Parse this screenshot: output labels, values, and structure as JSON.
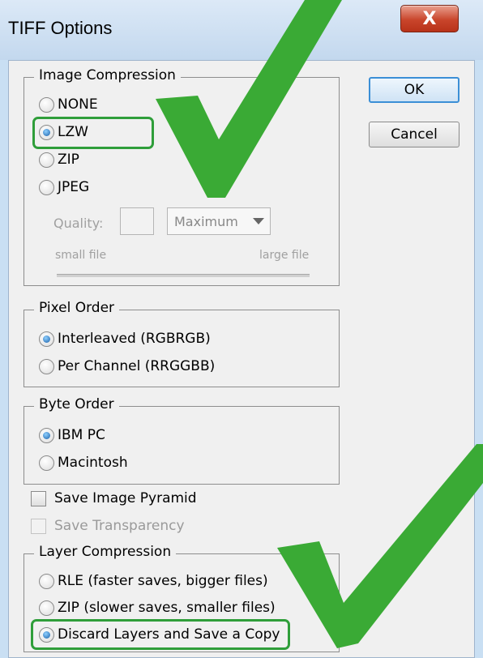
{
  "window": {
    "title": "TIFF Options",
    "close_label": "X"
  },
  "buttons": {
    "ok_label": "OK",
    "cancel_label": "Cancel"
  },
  "image_compression": {
    "legend": "Image Compression",
    "options": [
      "NONE",
      "LZW",
      "ZIP",
      "JPEG"
    ],
    "selected": "LZW",
    "quality_label": "Quality:",
    "quality_value": "",
    "quality_select": "Maximum",
    "small_file_label": "small file",
    "large_file_label": "large file"
  },
  "pixel_order": {
    "legend": "Pixel Order",
    "options": [
      "Interleaved (RGBRGB)",
      "Per Channel (RRGGBB)"
    ],
    "selected": "Interleaved (RGBRGB)"
  },
  "byte_order": {
    "legend": "Byte Order",
    "options": [
      "IBM PC",
      "Macintosh"
    ],
    "selected": "IBM PC"
  },
  "checkboxes": {
    "save_image_pyramid": "Save Image Pyramid",
    "save_transparency": "Save Transparency"
  },
  "layer_compression": {
    "legend": "Layer Compression",
    "options": [
      "RLE (faster saves, bigger files)",
      "ZIP (slower saves, smaller files)",
      "Discard Layers and Save a Copy"
    ],
    "selected": "Discard Layers and Save a Copy"
  },
  "colors": {
    "highlight_green": "#2f9e3a",
    "checkmark_green": "#3aaa35",
    "close_button_red": "#c9452b",
    "default_button_border": "#3b8fd6"
  },
  "icons": [
    "close-icon",
    "checkmark-icon",
    "dropdown-arrow-icon"
  ]
}
